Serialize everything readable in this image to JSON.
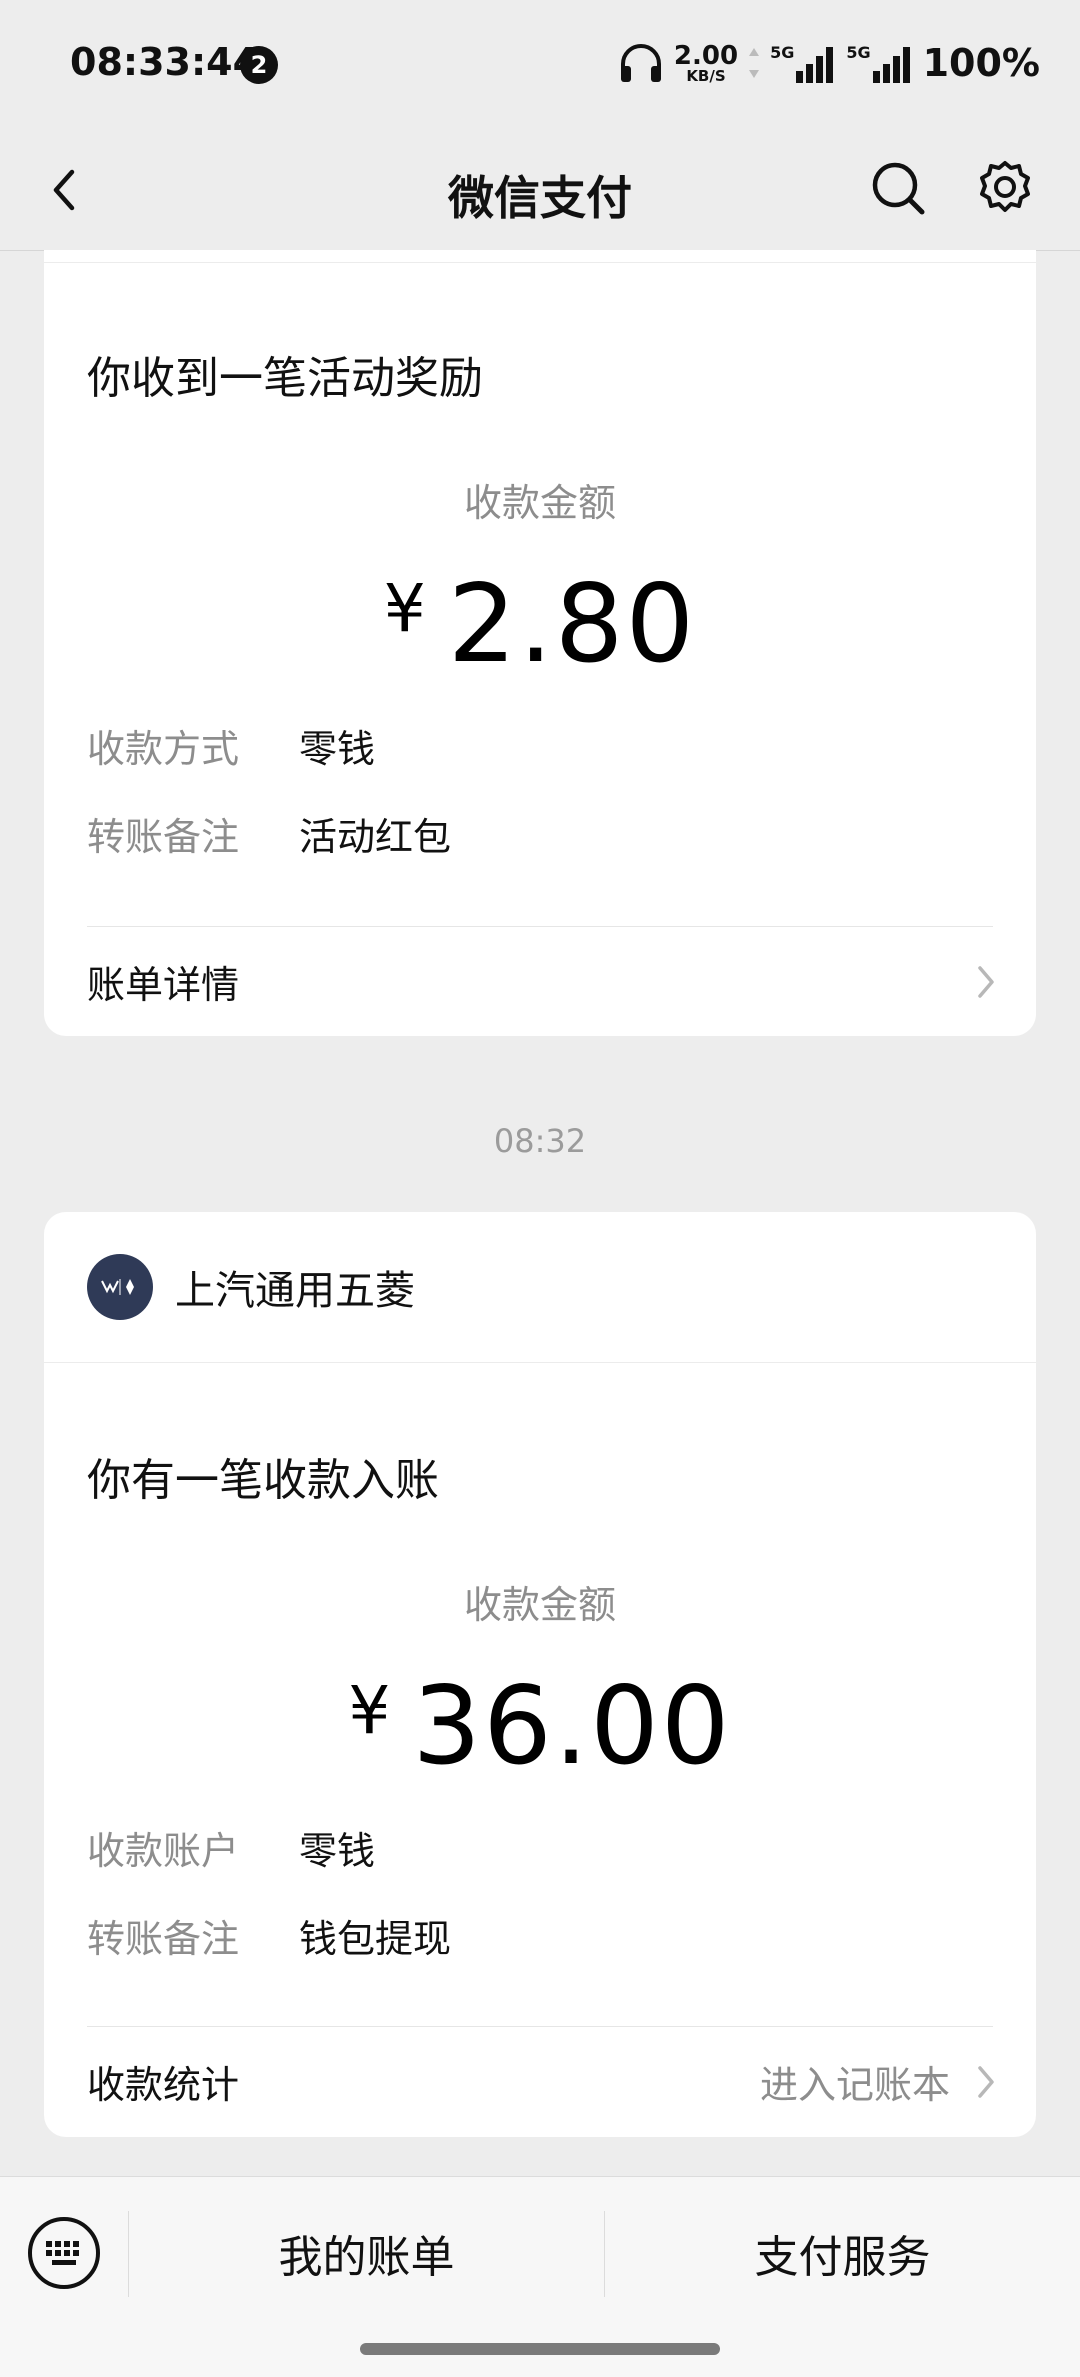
{
  "status_bar": {
    "time": "08:33:44",
    "notification_count": "2",
    "net_speed_value": "2.00",
    "net_speed_unit": "KB/S",
    "signal1_label": "5G",
    "signal2_label": "5G",
    "battery": "100%"
  },
  "nav": {
    "title": "微信支付",
    "icons": [
      "chevron-left-icon",
      "search-icon",
      "gear-icon"
    ]
  },
  "messages": [
    {
      "heading": "你收到一笔活动奖励",
      "amount_label": "收款金额",
      "currency": "¥",
      "amount": "2.80",
      "rows": [
        {
          "key": "收款方式",
          "value": "零钱"
        },
        {
          "key": "转账备注",
          "value": "活动红包"
        }
      ],
      "footer_left": "账单详情",
      "footer_right": ""
    },
    {
      "timestamp": "08:32",
      "merchant_name": "上汽通用五菱",
      "heading": "你有一笔收款入账",
      "amount_label": "收款金额",
      "currency": "¥",
      "amount": "36.00",
      "rows": [
        {
          "key": "收款账户",
          "value": "零钱"
        },
        {
          "key": "转账备注",
          "value": "钱包提现"
        }
      ],
      "footer_left": "收款统计",
      "footer_right": "进入记账本"
    }
  ],
  "bottom_bar": {
    "bills_label": "我的账单",
    "service_label": "支付服务"
  },
  "colors": {
    "background": "#ededed",
    "card": "#ffffff",
    "muted_text": "#8d8d8d",
    "merchant_logo": "#2f3a57"
  }
}
